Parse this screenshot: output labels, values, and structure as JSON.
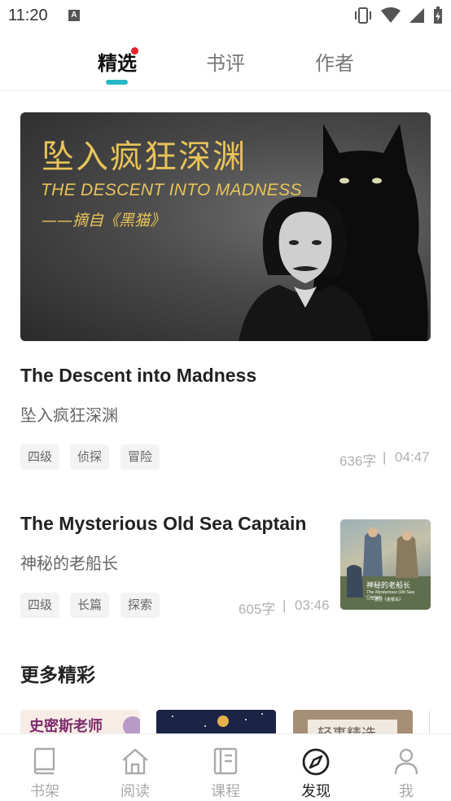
{
  "status_bar": {
    "time": "11:20",
    "notification_badge": "A"
  },
  "tabs": [
    {
      "label": "精选",
      "active": true,
      "has_dot": true
    },
    {
      "label": "书评",
      "active": false
    },
    {
      "label": "作者",
      "active": false
    }
  ],
  "hero": {
    "title_cn": "坠入疯狂深渊",
    "title_en": "THE DESCENT INTO MADNESS",
    "subtitle": "——摘自《黑猫》"
  },
  "article1": {
    "title": "The Descent into Madness",
    "subtitle": "坠入疯狂深渊",
    "tags": [
      "四级",
      "侦探",
      "冒险"
    ],
    "word_count": "636字",
    "separator": "|",
    "duration": "04:47"
  },
  "article2": {
    "title": "The Mysterious Old Sea Captain",
    "subtitle": "神秘的老船长",
    "tags": [
      "四级",
      "长篇",
      "探索"
    ],
    "word_count": "605字",
    "separator": "|",
    "duration": "03:46",
    "thumb_title": "神秘的老船长",
    "thumb_en": "The Mysterious Old Sea Captain",
    "thumb_source": "——摘自《金银岛》"
  },
  "more": {
    "title": "更多精彩",
    "cards": [
      {
        "label": "史密斯老师"
      },
      {
        "label": ""
      },
      {
        "label": "轻事精选"
      },
      {
        "label": ""
      }
    ]
  },
  "bottom_nav": [
    {
      "label": "书架",
      "icon": "book-icon",
      "active": false
    },
    {
      "label": "阅读",
      "icon": "home-icon",
      "active": false
    },
    {
      "label": "课程",
      "icon": "course-icon",
      "active": false
    },
    {
      "label": "发现",
      "icon": "compass-icon",
      "active": true
    },
    {
      "label": "我",
      "icon": "person-icon",
      "active": false
    }
  ],
  "colors": {
    "accent": "#27b7c7",
    "dot": "#e5232b",
    "hero_text": "#e8c35a"
  }
}
